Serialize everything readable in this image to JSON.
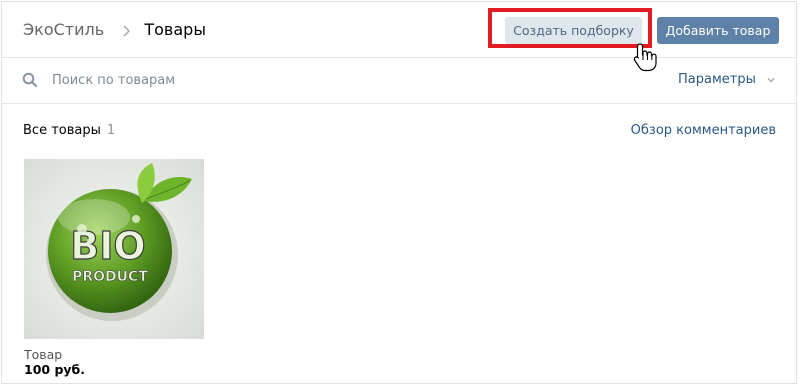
{
  "header": {
    "breadcrumb_root": "ЭкоСтиль",
    "breadcrumb_current": "Товары",
    "create_collection_label": "Создать подборку",
    "add_product_label": "Добавить товар"
  },
  "search": {
    "placeholder": "Поиск по товарам",
    "params_label": "Параметры"
  },
  "section": {
    "title": "Все товары",
    "count": "1",
    "review_link": "Обзор комментариев"
  },
  "products": [
    {
      "name": "Товар",
      "price": "100 руб.",
      "image_text_line1": "BIO",
      "image_text_line2": "PRODUCT"
    }
  ],
  "colors": {
    "primary_button": "#5e81a8",
    "secondary_button": "#dfe6ed",
    "link": "#2a5885",
    "highlight_frame": "#e11b22",
    "leaf_green": "#6fb52c"
  },
  "icons": [
    "chevron-right-icon",
    "search-icon",
    "chevron-down-icon",
    "hand-cursor-icon"
  ]
}
